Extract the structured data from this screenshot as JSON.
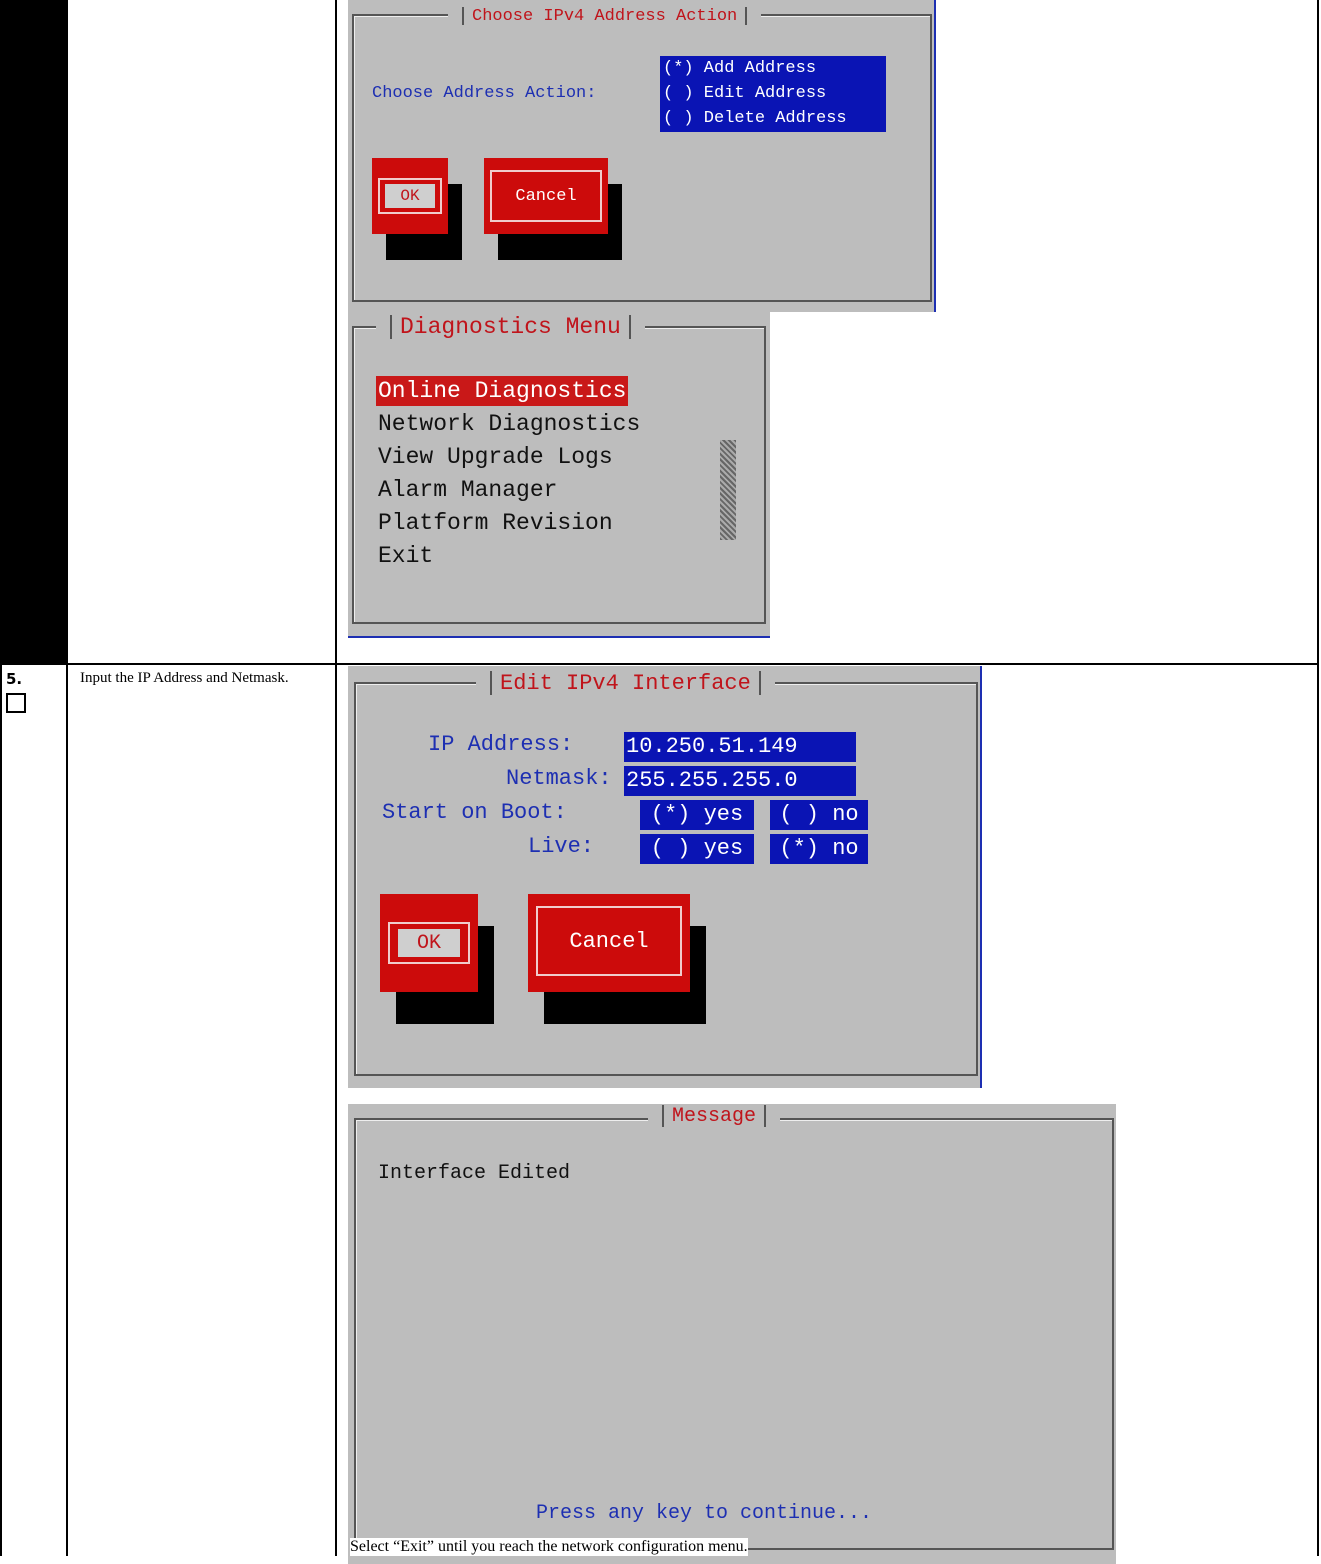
{
  "choose_ipv4": {
    "title": "Choose IPv4 Address Action",
    "label": "Choose Address Action:",
    "options": [
      "(*) Add Address",
      "( ) Edit Address",
      "( ) Delete Address"
    ],
    "ok": "OK",
    "cancel": "Cancel"
  },
  "diagnostics_menu": {
    "title": "Diagnostics Menu",
    "items": [
      "Online Diagnostics",
      "Network Diagnostics",
      "View Upgrade Logs",
      "Alarm Manager",
      "Platform Revision",
      "Exit"
    ],
    "selected_index": 0
  },
  "step": {
    "number": "5.",
    "instruction": "Input the IP Address and Netmask."
  },
  "edit_ipv4": {
    "title": "Edit IPv4 Interface",
    "ip_label": "IP Address:",
    "ip_value": "10.250.51.149",
    "netmask_label": "Netmask:",
    "netmask_value": "255.255.255.0",
    "boot_label": "Start on Boot:",
    "boot_yes": "(*) yes",
    "boot_no": "( ) no",
    "live_label": "Live:",
    "live_yes": "( ) yes",
    "live_no": "(*) no",
    "ok": "OK",
    "cancel": "Cancel"
  },
  "message": {
    "title": "Message",
    "body": "Interface Edited",
    "prompt": "Press any key to continue..."
  },
  "footer_note": "Select “Exit” until you reach the network configuration menu.",
  "colors": {
    "dialog_bg": "#bdbdbd",
    "title_red": "#c0141b",
    "label_blue": "#1d2fb2",
    "selection_blue": "#0a14b4",
    "button_red": "#cc0b0b"
  }
}
